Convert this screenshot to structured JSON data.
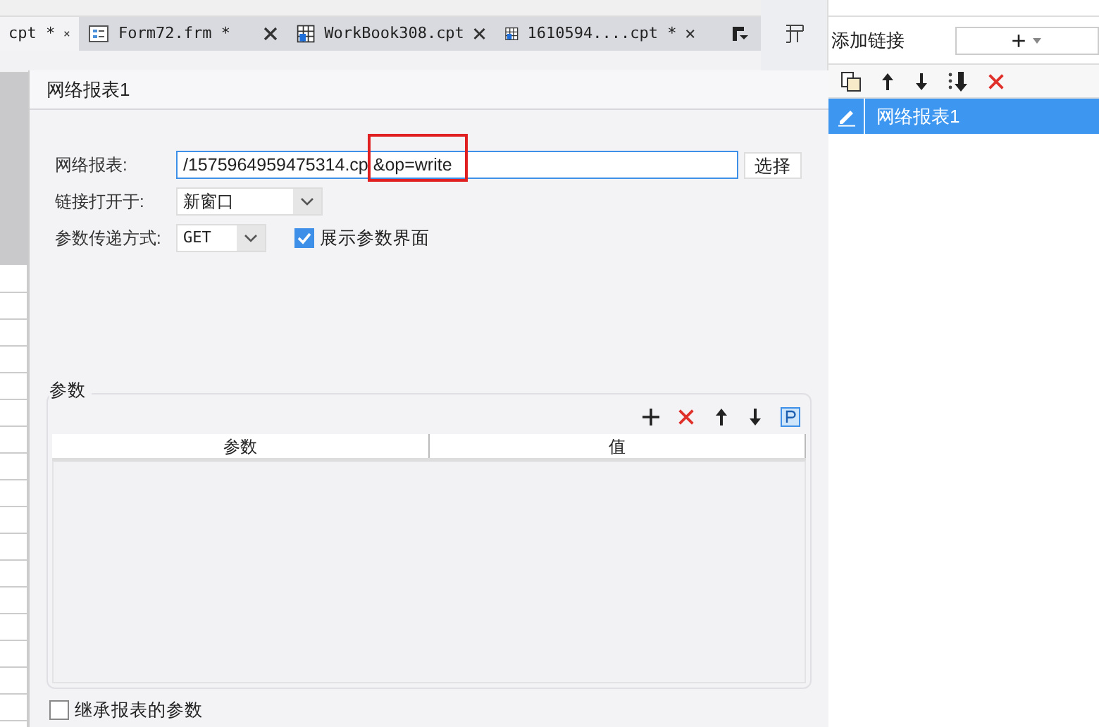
{
  "tabs": [
    {
      "label": "cpt *",
      "selected": true,
      "kind": "partial"
    },
    {
      "label": "Form72.frm *",
      "selected": false,
      "kind": "form"
    },
    {
      "label": "WorkBook308.cpt",
      "selected": false,
      "kind": "grid"
    },
    {
      "label": "1610594....cpt *",
      "selected": false,
      "kind": "grid"
    }
  ],
  "dialog": {
    "title": "网络报表1",
    "report": {
      "label": "网络报表:",
      "value": "/1575964959475314.cp &op=write",
      "button": "选择"
    },
    "open_in": {
      "label": "链接打开于:",
      "value": "新窗口"
    },
    "method": {
      "label": "参数传递方式:",
      "value": "GET",
      "show_params": {
        "label": "展示参数界面",
        "checked": true
      }
    },
    "params": {
      "legend": "参数",
      "columns": [
        "参数",
        "值"
      ]
    },
    "inherit": {
      "label": "继承报表的参数",
      "checked": false
    }
  },
  "links_panel": {
    "add_label": "添加链接",
    "add_button": "+",
    "items": [
      {
        "label": "网络报表1",
        "selected": true
      }
    ]
  }
}
